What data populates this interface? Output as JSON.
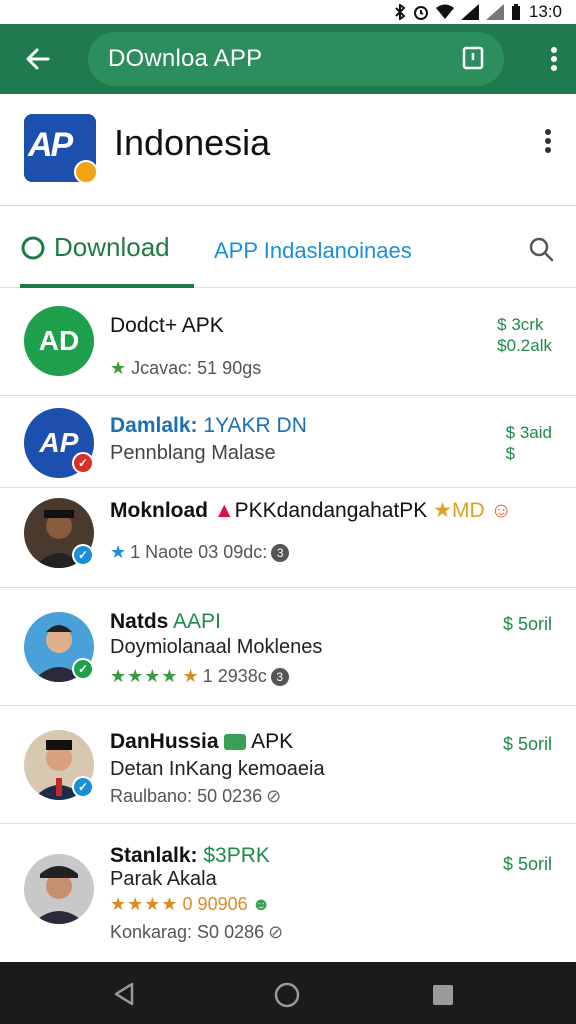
{
  "status_bar": {
    "time": "13:0"
  },
  "app_bar": {
    "url_text": "DOwnloa APP"
  },
  "header": {
    "title": "Indonesia",
    "logo_text": "AP"
  },
  "tabs": {
    "download_label": "Download",
    "app_label": "APP Indaslanoinaes"
  },
  "list": [
    {
      "avatar_text": "AD",
      "avatar_color": "#1fa04c",
      "title": "Dodct+ APK",
      "meta": "Jcavac: 51 90gs",
      "price_line1": "$ 3crk",
      "price_line2": "$0.2alk"
    },
    {
      "avatar_text": "AP",
      "avatar_color": "#1d4fae",
      "title_a": "Damlalk:",
      "title_b": "1YAKR DN",
      "sub": "Pennblang Malase",
      "price_line1": "$ 3aid",
      "price_line2": "$"
    },
    {
      "title": "Moknload",
      "title_rest": "PKKdandangahatPK",
      "title_tail": "MD",
      "meta": "1 Naote 03 09dc:"
    },
    {
      "title_a": "Natds",
      "title_b": "AAPI",
      "sub": "Doymiolanaal Moklenes",
      "meta": "1 2938c",
      "price_line1": "$ 5oril"
    },
    {
      "title_a": "DanHussia",
      "title_b": "APK",
      "sub": "Detan InKang kemoaeia",
      "meta": "Raulbano: 50 0236",
      "price_line1": "$ 5oril"
    },
    {
      "title_a": "Stanlalk:",
      "title_b": "$3PRK",
      "sub": "Parak Akala",
      "meta_a": "0 90906",
      "meta": "Konkarag: S0 0286",
      "price_line1": "$ 5oril"
    }
  ],
  "colors": {
    "appbar": "#1f7a4d",
    "accent_green": "#1e7b43",
    "link_blue": "#1b8fd8"
  }
}
